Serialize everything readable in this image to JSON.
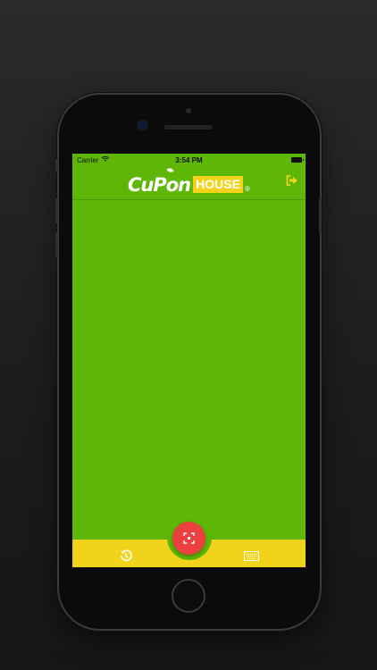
{
  "status_bar": {
    "carrier": "Carrier",
    "time": "3:54 PM"
  },
  "header": {
    "logo_main": "CuPon",
    "logo_house": "HOUSE",
    "logo_reg": "®",
    "logout_icon": "sign-out-icon"
  },
  "tab_bar": {
    "history_icon": "history-icon",
    "scan_icon": "scan-icon",
    "keyboard_icon": "keyboard-icon"
  },
  "colors": {
    "background": "#1c1c1c",
    "screen_green": "#5eb706",
    "tab_yellow": "#f2d31b",
    "scan_red": "#ec4040"
  }
}
